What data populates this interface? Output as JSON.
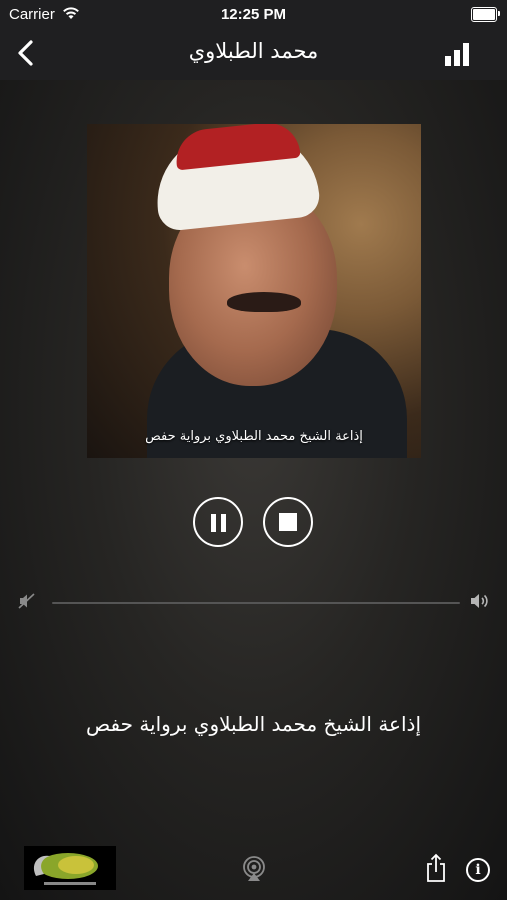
{
  "status_bar": {
    "carrier": "Carrier",
    "time": "12:25 PM"
  },
  "nav": {
    "title": "محمد الطبلاوي",
    "back_icon": "chevron-left-icon",
    "menu_icon": "bars-chart-icon"
  },
  "artwork": {
    "caption": "إذاعة الشيخ محمد الطبلاوي برواية حفص"
  },
  "controls": {
    "pause_icon": "pause-icon",
    "stop_icon": "stop-icon"
  },
  "volume": {
    "level": 0
  },
  "station": {
    "title": "إذاعة الشيخ محمد الطبلاوي برواية حفص"
  },
  "toolbar": {
    "logo_icon": "quran-radio-logo",
    "airplay_icon": "airplay-icon",
    "share_icon": "share-icon",
    "info_label": "i"
  },
  "colors": {
    "bar_background": "#1f1f21",
    "text": "#ffffff",
    "cap_red": "#b22123"
  }
}
